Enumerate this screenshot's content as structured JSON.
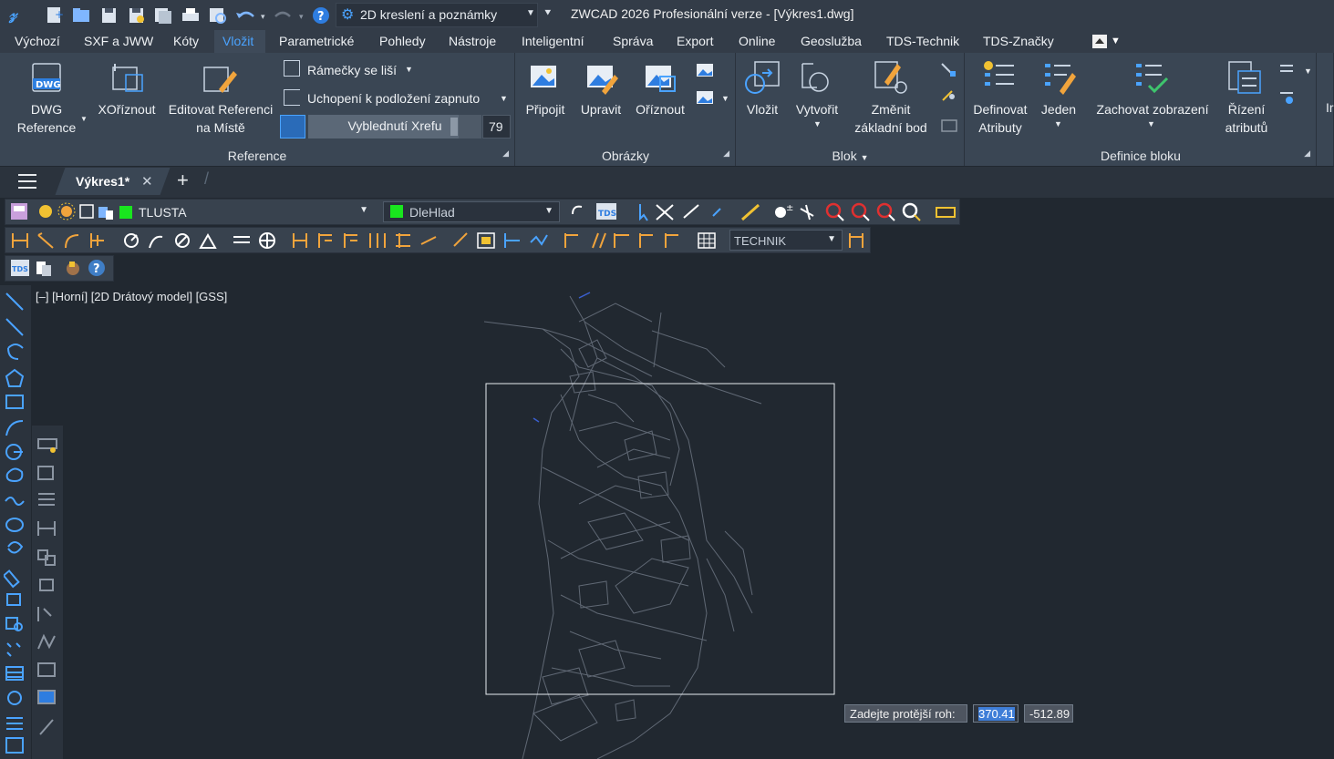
{
  "app": {
    "title": "ZWCAD 2026 Profesionální verze - [Výkres1.dwg]",
    "workspace": "2D kreslení a poznámky"
  },
  "menu": [
    "Výchozí",
    "SXF a JWW",
    "Kóty",
    "Vložit",
    "Parametrické",
    "Pohledy",
    "Nástroje",
    "Inteligentní",
    "Správa",
    "Export",
    "Online",
    "Geoslužba",
    "TDS-Technik",
    "TDS-Značky"
  ],
  "ribbon": {
    "reference": {
      "title": "Reference",
      "dwg_icon_text": "DWG",
      "dwg_label": "DWG\nReference",
      "dwg_label_1": "DWG",
      "dwg_label_2": "Reference",
      "xclip": "XOříznout",
      "edit_ref_1": "Editovat Referenci",
      "edit_ref_2": "na Místě",
      "frames": "Rámečky se liší",
      "snap": "Uchopení k podložení zapnuto",
      "fade_label": "Vyblednutí Xrefu",
      "fade_value": "79"
    },
    "images": {
      "title": "Obrázky",
      "attach": "Připojit",
      "adjust": "Upravit",
      "clip": "Oříznout"
    },
    "block": {
      "title": "Blok",
      "insert": "Vložit",
      "create": "Vytvořit",
      "change_1": "Změnit",
      "change_2": "základní bod"
    },
    "block_def": {
      "title": "Definice bloku",
      "define_1": "Definovat",
      "define_2": "Atributy",
      "single": "Jeden",
      "retain": "Zachovat zobrazení",
      "manage_1": "Řízení",
      "manage_2": "atributů",
      "cut": "Ir"
    }
  },
  "doc_tab": "Výkres1*",
  "layer": {
    "name": "TLUSTA",
    "color_name": "DleHlad",
    "style": "TECHNIK",
    "layer_color": "#19e61e"
  },
  "viewport": "[–] [Horní] [2D Drátový model] [GSS]",
  "command": {
    "prompt": "Zadejte protější roh:",
    "x": "370.41",
    "y": "-512.89"
  },
  "colors": {
    "accent": "#4aa3ff",
    "background": "#212830"
  }
}
